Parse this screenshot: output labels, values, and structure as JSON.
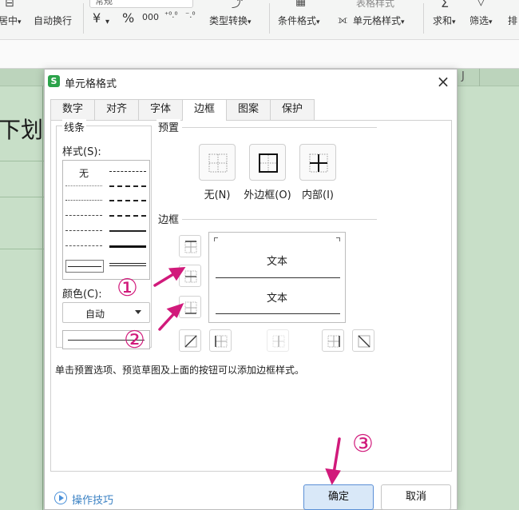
{
  "ribbon": {
    "merge_center_partial": "居中",
    "wrap_text": "自动换行",
    "currency_symbol": "¥",
    "percent_symbol": "%",
    "thousands_symbol": "000",
    "decimal_increase": "⁺⁰.⁰",
    "decimal_decrease": "⁻.⁰",
    "type_convert": "类型转换",
    "conditional_format": "条件格式",
    "cell_style": "单元格样式",
    "table_style_partial": "表格样式",
    "sum": "求和",
    "filter": "筛选",
    "sort_partial": "排",
    "number_format_value": "常规"
  },
  "sheet": {
    "column_j": "J",
    "cell_text_partial": "下划"
  },
  "dialog": {
    "title": "单元格格式",
    "logo": "S",
    "close_symbol": "×",
    "tabs": [
      {
        "label": "数字"
      },
      {
        "label": "对齐"
      },
      {
        "label": "字体"
      },
      {
        "label": "边框"
      },
      {
        "label": "图案"
      },
      {
        "label": "保护"
      }
    ],
    "line_group_label": "线条",
    "style_label": "样式(S):",
    "style_none": "无",
    "color_label": "颜色(C):",
    "color_value": "自动",
    "preset_group_label": "预置",
    "presets": [
      {
        "label": "无(N)"
      },
      {
        "label": "外边框(O)"
      },
      {
        "label": "内部(I)"
      }
    ],
    "border_group_label": "边框",
    "preview_text_top": "文本",
    "preview_text_bottom": "文本",
    "hint": "单击预置选项、预览草图及上面的按钮可以添加边框样式。",
    "tips_label": "操作技巧",
    "ok_label": "确定",
    "cancel_label": "取消"
  },
  "annotations": {
    "step1": "①",
    "step2": "②",
    "step3": "③",
    "color": "#d11a7b"
  }
}
